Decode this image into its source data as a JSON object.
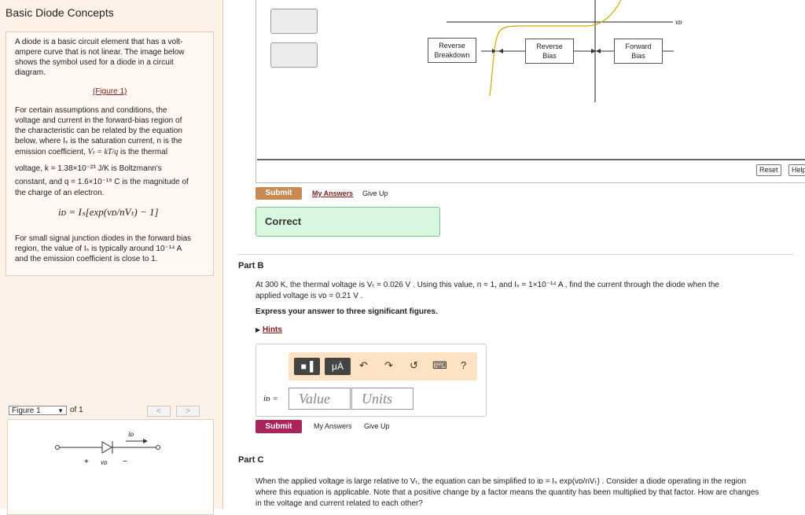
{
  "app": {
    "title": "Basic Diode Concepts"
  },
  "intro": {
    "paragraph1": [
      "A diode is a basic circuit element that has a volt-",
      "ampere curve that is not linear. The image below",
      "shows the symbol used for a diode in a circuit",
      "diagram."
    ],
    "figure_link": "(Figure 1)",
    "paragraph2_lines": [
      "For certain assumptions and conditions, the",
      "voltage and current in the forward-bias region of",
      "the characteristic can be related by the equation",
      "below, where Iₛ is the saturation current, n is the"
    ],
    "emission_line": "emission coefficient,",
    "vt_def": "Vₜ = kT/q",
    "thermal_text": "is the thermal",
    "k_line": "voltage, k = 1.38×10⁻²³ J/K is Boltzmann's",
    "q_line": "constant, and q = 1.6×10⁻¹⁹ C is the magnitude of",
    "charge_line": "the charge of an electron.",
    "equation": "iᴅ = Iₛ[exp(vᴅ/nVₜ) − 1]",
    "small_signal": [
      "For small signal junction diodes in the forward bias",
      "region, the value of Iₛ is typically around 10⁻¹⁴ A",
      "and the emission coefficient is close to 1."
    ]
  },
  "figure_nav": {
    "selected": "Figure 1",
    "of_label": "of 1",
    "prev": "<",
    "next": ">"
  },
  "figure": {
    "current_label": "iᴅ",
    "plus": "+",
    "voltage_label": "vᴅ",
    "minus": "−"
  },
  "graph": {
    "axis_label": "vᴅ",
    "labels": [
      {
        "lines": [
          "Reverse",
          "Breakdown"
        ]
      },
      {
        "lines": [
          "Reverse",
          "Bias"
        ]
      },
      {
        "lines": [
          "Forward",
          "Bias"
        ]
      }
    ],
    "reset": "Reset",
    "help": "Help"
  },
  "partA": {
    "submit": "Submit",
    "my_answers": "My Answers",
    "give_up": "Give Up",
    "feedback": "Correct"
  },
  "partB": {
    "heading": "Part B",
    "question_line1": "At 300 K, the thermal voltage is Vₜ = 0.026 V . Using this value, n = 1, and Iₛ = 1×10⁻¹⁴ A , find the current through the diode when the",
    "question_line2": "applied voltage is vᴅ = 0.21 V .",
    "instruction": "Express your answer to three significant figures.",
    "hints": "Hints",
    "toolbar": {
      "templates": "■▐",
      "mu": "μȦ",
      "undo": "↶",
      "redo": "↷",
      "reset": "↺",
      "keyboard": "⌨",
      "help": "?"
    },
    "answer_label": "iᴅ =",
    "value_placeholder": "Value",
    "units_placeholder": "Units",
    "submit": "Submit",
    "my_answers": "My Answers",
    "give_up": "Give Up"
  },
  "partC": {
    "heading": "Part C",
    "line1": "When the applied voltage is large relative to Vₜ, the equation can be simplified to iᴅ = Iₛ exp(vᴅ/nVₜ) . Consider a diode operating in the region",
    "line2": "where this equation is applicable. Note that a positive change by a factor means the quantity has been multiplied by that factor. How are changes",
    "line3": "in the voltage and current related to each other?"
  }
}
